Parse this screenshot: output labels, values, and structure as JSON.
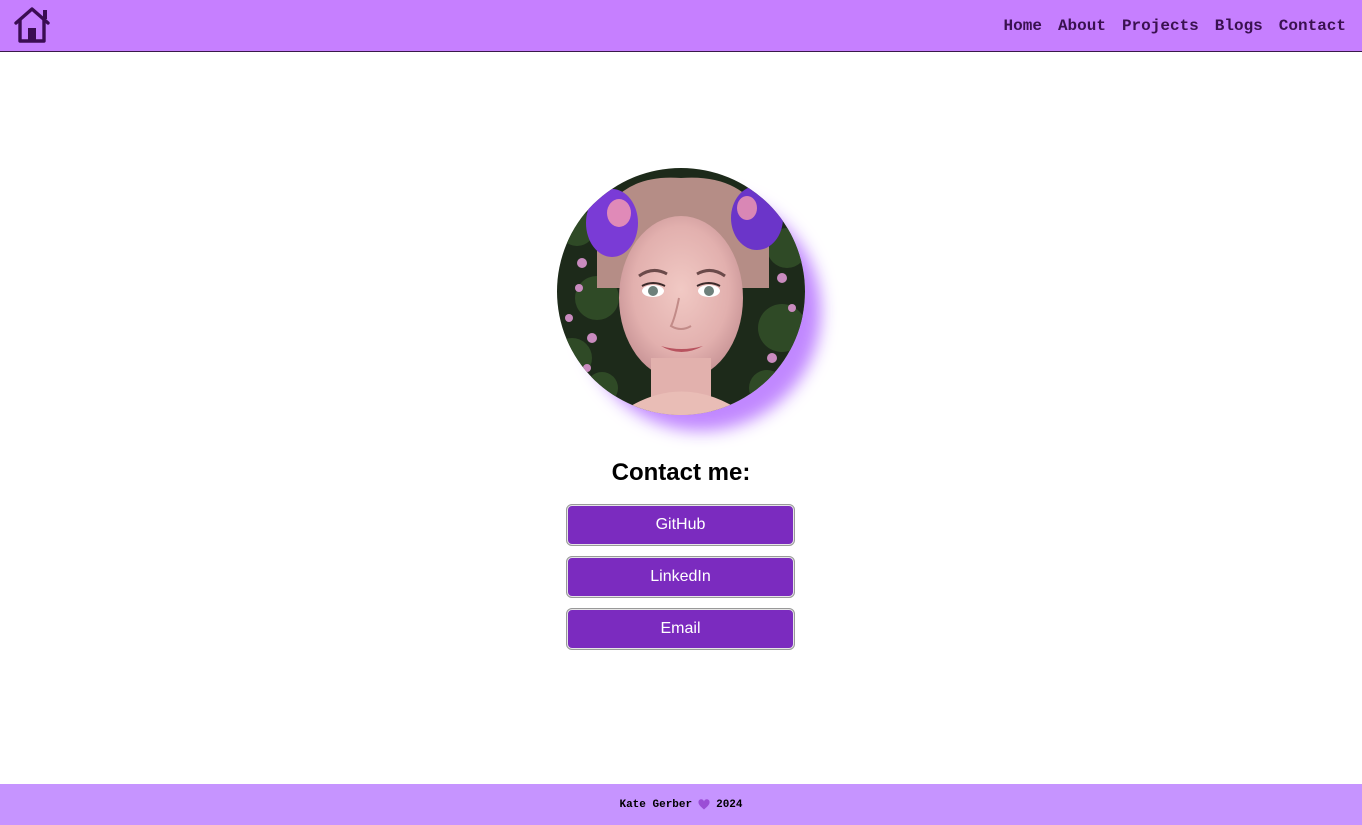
{
  "nav": {
    "home_icon": "home-icon",
    "links": [
      {
        "label": "Home"
      },
      {
        "label": "About"
      },
      {
        "label": "Projects"
      },
      {
        "label": "Blogs"
      },
      {
        "label": "Contact"
      }
    ]
  },
  "profile": {
    "photo": "profile-photo"
  },
  "contact": {
    "title": "Contact me:",
    "buttons": [
      {
        "label": "GitHub"
      },
      {
        "label": "LinkedIn"
      },
      {
        "label": "Email"
      }
    ]
  },
  "footer": {
    "name": "Kate Gerber",
    "heart_icon": "purple-heart-icon",
    "year": "2024"
  },
  "colors": {
    "nav_bg": "#c67fff",
    "footer_bg": "#c694ff",
    "button_bg": "#7b2bbf",
    "accent_shadow": "#be82ff"
  }
}
